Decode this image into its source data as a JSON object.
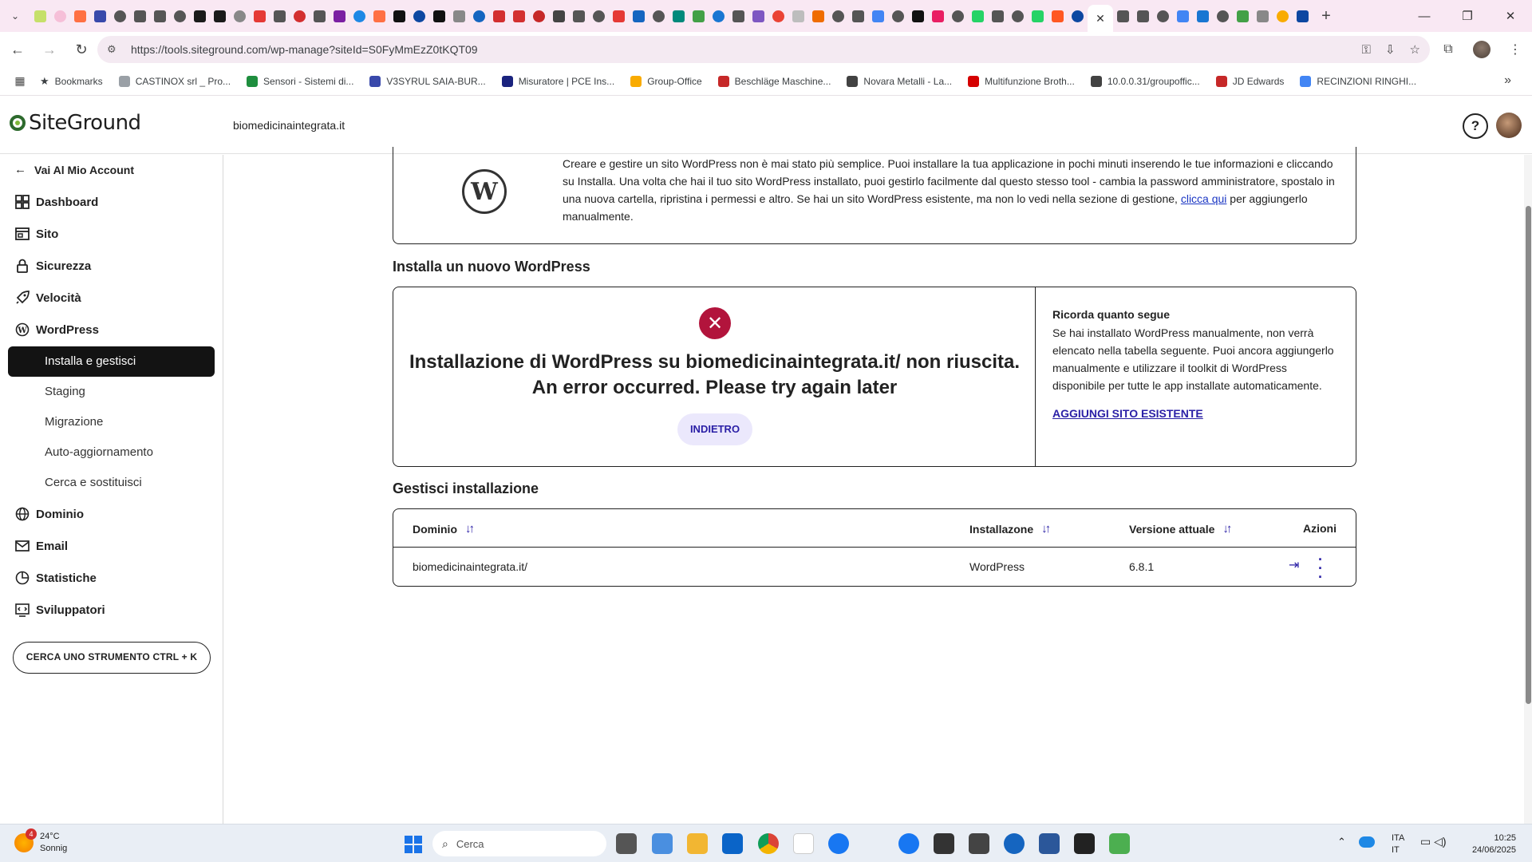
{
  "browser": {
    "tab_menu_icon": "chevron-down",
    "active_tab_close": "✕",
    "new_tab": "+",
    "window_controls": [
      "—",
      "❐",
      "✕"
    ],
    "url": "https://tools.siteground.com/wp-manage?siteId=S0FyMmEzZ0tKQT09",
    "bookmarks_label": "Bookmarks",
    "bookmarks": [
      {
        "label": "CASTINOX srl _ Pro...",
        "color": "#9aa0a6"
      },
      {
        "label": "Sensori - Sistemi di...",
        "color": "#1e8e3e"
      },
      {
        "label": "V3SYRUL SAIA-BUR...",
        "color": "#3949ab"
      },
      {
        "label": "Misuratore | PCE Ins...",
        "color": "#1a237e"
      },
      {
        "label": "Group-Office",
        "color": "#f9ab00"
      },
      {
        "label": "Beschläge Maschine...",
        "color": "#c62828"
      },
      {
        "label": "Novara Metalli - La...",
        "color": "#424242"
      },
      {
        "label": "Multifunzione Broth...",
        "color": "#d50000"
      },
      {
        "label": "10.0.0.31/groupoffic...",
        "color": "#424242"
      },
      {
        "label": "JD Edwards",
        "color": "#c62828"
      },
      {
        "label": "RECINZIONI RINGHI...",
        "color": "#4285f4"
      }
    ],
    "tab_favicons": [
      "#c6e06a",
      "#f6bfd8",
      "#ff7043",
      "#3949ab",
      "#555555",
      "#555555",
      "#555555",
      "#555555",
      "#1a1a1a",
      "#1a1a1a",
      "#888888",
      "#e53935",
      "#555555",
      "#d32f2f",
      "#555555",
      "#7b1fa2",
      "#1e88e5",
      "#ff7043",
      "#111111",
      "#0d47a1",
      "#111111",
      "#888888",
      "#1565c0",
      "#d32f2f",
      "#d32f2f",
      "#c62828",
      "#444444",
      "#555555",
      "#555555",
      "#e53935",
      "#1565c0",
      "#555555",
      "#00897b",
      "#43a047",
      "#1976d2",
      "#555555",
      "#7e57c2",
      "#ea4335",
      "#bdbdbd",
      "#ef6c00",
      "#555555",
      "#555555",
      "#4285f4",
      "#555555",
      "#111111",
      "#e91e63",
      "#555555",
      "#25d366",
      "#555555",
      "#555555",
      "#25d366",
      "#ff5722",
      "#0d47a1",
      "#555555",
      "#555555",
      "#555555",
      "#4285f4",
      "#1976d2",
      "#555555",
      "#43a047",
      "#888888",
      "#f9ab00",
      "#0d47a1"
    ]
  },
  "header": {
    "logo_text": "SiteGround",
    "site_name": "biomedicinaintegrata.it",
    "help_icon": "?"
  },
  "sidebar": {
    "back_label": "Vai Al Mio Account",
    "items": [
      {
        "label": "Dashboard",
        "icon": "dashboard-icon"
      },
      {
        "label": "Sito",
        "icon": "site-icon"
      },
      {
        "label": "Sicurezza",
        "icon": "lock-icon"
      },
      {
        "label": "Velocità",
        "icon": "rocket-icon"
      },
      {
        "label": "WordPress",
        "icon": "wordpress-icon"
      },
      {
        "label": "Dominio",
        "icon": "globe-icon"
      },
      {
        "label": "Email",
        "icon": "mail-icon"
      },
      {
        "label": "Statistiche",
        "icon": "chart-icon"
      },
      {
        "label": "Sviluppatori",
        "icon": "code-icon"
      }
    ],
    "wordpress_sub": [
      "Installa e gestisci",
      "Staging",
      "Migrazione",
      "Auto-aggiornamento",
      "Cerca e sostituisci"
    ],
    "active_sub": "Installa e gestisci",
    "search_tool": "CERCA UNO STRUMENTO CTRL + K"
  },
  "intro": {
    "text_before_link": "Creare e gestire un sito WordPress non è mai stato più semplice. Puoi installare la tua applicazione in pochi minuti inserendo le tue informazioni e cliccando su Installa. Una volta che hai il tuo sito WordPress installato, puoi gestirlo facilmente dal questo stesso tool - cambia la password amministratore, spostalo in una nuova cartella, ripristina i permessi e altro. Se hai un sito WordPress esistente, ma non lo vedi nella sezione di gestione, ",
    "link": "clicca qui",
    "text_after_link": " per aggiungerlo manualmente."
  },
  "install": {
    "section_title": "Installa un nuovo WordPress",
    "error_line1": "Installazione di WordPress su biomedicinaintegrata.it/ non riuscita.",
    "error_line2": "An error occurred. Please try again later",
    "back_button": "INDIETRO",
    "reminder_title": "Ricorda quanto segue",
    "reminder_text": "Se hai installato WordPress manualmente, non verrà elencato nella tabella seguente. Puoi ancora aggiungerlo manualmente e utilizzare il toolkit di WordPress disponibile per tutte le app installate automaticamente.",
    "add_existing_link": "AGGIUNGI SITO ESISTENTE"
  },
  "manage": {
    "section_title": "Gestisci installazione",
    "columns": [
      "Dominio",
      "Installazone",
      "Versione attuale",
      "Azioni"
    ],
    "rows": [
      {
        "domain": "biomedicinaintegrata.it/",
        "installation": "WordPress",
        "version": "6.8.1"
      }
    ]
  },
  "taskbar": {
    "weather_badge": "4",
    "temperature": "24°C",
    "weather_desc": "Sonnig",
    "search_placeholder": "Cerca",
    "language": "ITA",
    "language_sub": "IT",
    "time": "10:25",
    "date": "24/06/2025"
  }
}
